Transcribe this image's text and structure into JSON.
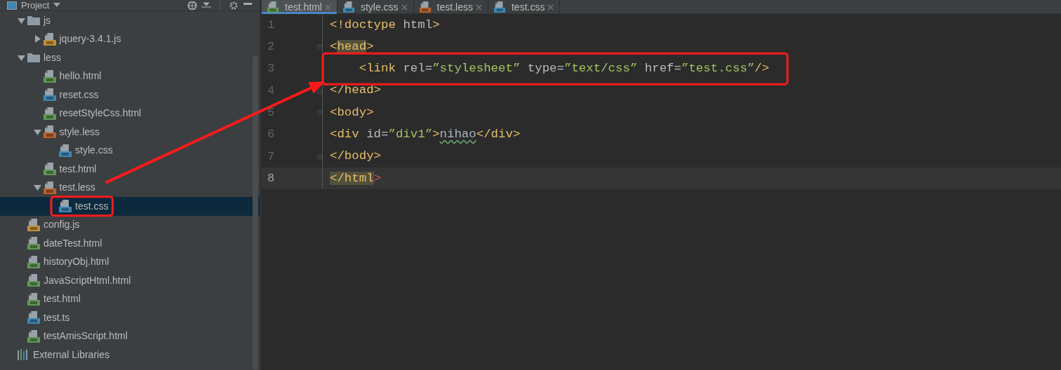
{
  "sidebar": {
    "title": "Project",
    "tree": [
      {
        "label": "js",
        "kind": "folder",
        "expanded": true,
        "selected": false,
        "marked": false,
        "children": [
          {
            "label": "jquery-3.4.1.js",
            "kind": "js",
            "expanded": false,
            "selected": false,
            "marked": false
          }
        ]
      },
      {
        "label": "less",
        "kind": "folder",
        "expanded": true,
        "selected": false,
        "marked": false,
        "children": [
          {
            "label": "hello.html",
            "kind": "html",
            "selected": false,
            "marked": false
          },
          {
            "label": "reset.css",
            "kind": "css",
            "selected": false,
            "marked": false
          },
          {
            "label": "resetStyleCss.html",
            "kind": "html",
            "selected": false,
            "marked": false
          },
          {
            "label": "style.less",
            "kind": "less",
            "expanded": true,
            "selected": false,
            "marked": false,
            "children": [
              {
                "label": "style.css",
                "kind": "css",
                "selected": false,
                "marked": false
              }
            ]
          },
          {
            "label": "test.html",
            "kind": "html",
            "selected": false,
            "marked": false
          },
          {
            "label": "test.less",
            "kind": "less",
            "expanded": true,
            "selected": false,
            "marked": false,
            "children": [
              {
                "label": "test.css",
                "kind": "css",
                "selected": true,
                "marked": true
              }
            ]
          }
        ]
      },
      {
        "label": "config.js",
        "kind": "js",
        "selected": false,
        "marked": false
      },
      {
        "label": "dateTest.html",
        "kind": "html",
        "selected": false,
        "marked": false
      },
      {
        "label": "historyObj.html",
        "kind": "html",
        "selected": false,
        "marked": false
      },
      {
        "label": "JavaScriptHtml.html",
        "kind": "html",
        "selected": false,
        "marked": false
      },
      {
        "label": "test.html",
        "kind": "html",
        "selected": false,
        "marked": false
      },
      {
        "label": "test.ts",
        "kind": "ts",
        "selected": false,
        "marked": false
      },
      {
        "label": "testAmisScript.html",
        "kind": "html",
        "selected": false,
        "marked": false
      }
    ],
    "footer_item": {
      "label": "External Libraries",
      "kind": "libraries"
    }
  },
  "tabs": [
    {
      "label": "test.html",
      "kind": "html",
      "selected": true
    },
    {
      "label": "style.css",
      "kind": "css",
      "selected": false
    },
    {
      "label": "test.less",
      "kind": "less",
      "selected": false
    },
    {
      "label": "test.css",
      "kind": "css",
      "selected": false
    }
  ],
  "editor": {
    "lines": [
      {
        "number": "1",
        "kind": "plain",
        "current": false,
        "marked": false,
        "tokens": [
          {
            "t": "<!doctype ",
            "kind": "tag"
          },
          {
            "t": "html",
            "kind": "attr"
          },
          {
            "t": ">",
            "kind": "tag"
          }
        ]
      },
      {
        "number": "2",
        "kind": "fold-start",
        "current": false,
        "marked": false,
        "tokens": [
          {
            "t": "<",
            "kind": "tag"
          },
          {
            "t": "head",
            "kind": "tag",
            "match": true
          },
          {
            "t": ">",
            "kind": "tag"
          }
        ]
      },
      {
        "number": "3",
        "kind": "plain",
        "current": false,
        "marked": true,
        "tokens": [
          {
            "t": "    <link ",
            "kind": "tag"
          },
          {
            "t": "rel=",
            "kind": "attr"
          },
          {
            "t": "”stylesheet”",
            "kind": "str"
          },
          {
            "t": " type=",
            "kind": "attr"
          },
          {
            "t": "”text/css”",
            "kind": "str"
          },
          {
            "t": " href=",
            "kind": "attr"
          },
          {
            "t": "”test.css”",
            "kind": "str"
          },
          {
            "t": "/>",
            "kind": "tag"
          }
        ]
      },
      {
        "number": "4",
        "kind": "fold-end",
        "current": false,
        "marked": false,
        "tokens": [
          {
            "t": "</head>",
            "kind": "tag"
          }
        ]
      },
      {
        "number": "5",
        "kind": "fold-start",
        "current": false,
        "marked": false,
        "tokens": [
          {
            "t": "<body>",
            "kind": "tag"
          }
        ]
      },
      {
        "number": "6",
        "kind": "plain",
        "current": false,
        "marked": false,
        "tokens": [
          {
            "t": "<div ",
            "kind": "tag"
          },
          {
            "t": "id=",
            "kind": "attr"
          },
          {
            "t": "”div1”",
            "kind": "str"
          },
          {
            "t": ">",
            "kind": "tag"
          },
          {
            "t": "nihao",
            "kind": "text",
            "typo": true
          },
          {
            "t": "</div>",
            "kind": "tag"
          }
        ]
      },
      {
        "number": "7",
        "kind": "fold-end",
        "current": false,
        "marked": false,
        "tokens": [
          {
            "t": "</body>",
            "kind": "tag"
          }
        ]
      },
      {
        "number": "8",
        "kind": "plain",
        "current": true,
        "marked": false,
        "tokens": [
          {
            "t": "</html",
            "kind": "tag",
            "match": true
          },
          {
            "t": ">",
            "kind": "err"
          }
        ]
      }
    ]
  }
}
